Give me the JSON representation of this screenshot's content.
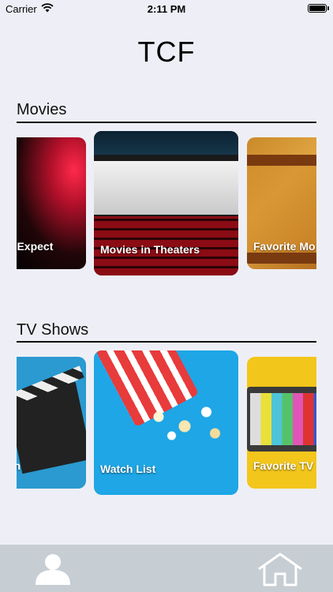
{
  "status_bar": {
    "carrier": "Carrier",
    "time": "2:11 PM"
  },
  "app": {
    "title": "TCF"
  },
  "sections": [
    {
      "title": "Movies",
      "cards": [
        {
          "label": "u Expect"
        },
        {
          "label": "Movies in Theaters"
        },
        {
          "label": "Favorite Mo"
        }
      ]
    },
    {
      "title": "TV Shows",
      "cards": [
        {
          "label": "on"
        },
        {
          "label": "Watch List"
        },
        {
          "label": "Favorite TV"
        }
      ]
    }
  ],
  "tab_bar": {
    "items": [
      {
        "icon": "user-icon"
      },
      {
        "icon": "home-icon"
      }
    ]
  },
  "colors": {
    "background": "#eeeff6",
    "tab_bar": "#c6cdd3",
    "icon_white": "#ffffff"
  }
}
